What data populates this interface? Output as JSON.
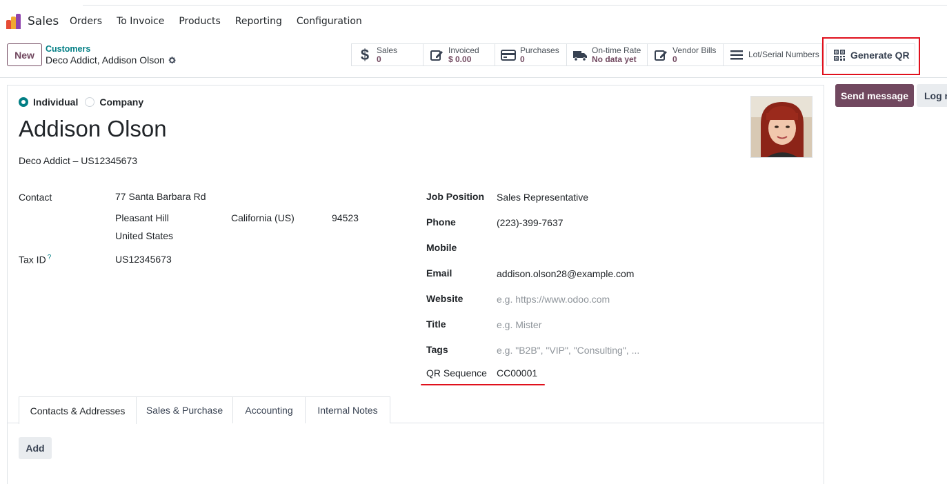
{
  "nav": {
    "app_name": "Sales",
    "menu": [
      "Orders",
      "To Invoice",
      "Products",
      "Reporting",
      "Configuration"
    ]
  },
  "control": {
    "new_label": "New",
    "breadcrumb_parent": "Customers",
    "breadcrumb_current": "Deco Addict, Addison Olson"
  },
  "smart_buttons": [
    {
      "label": "Sales",
      "value": "0",
      "icon": "dollar-icon"
    },
    {
      "label": "Invoiced",
      "value": "$ 0.00",
      "icon": "edit-invoice-icon"
    },
    {
      "label": "Purchases",
      "value": "0",
      "icon": "credit-card-icon"
    },
    {
      "label": "On-time Rate",
      "value": "No data yet",
      "icon": "truck-icon"
    },
    {
      "label": "Vendor Bills",
      "value": "0",
      "icon": "edit-bill-icon"
    },
    {
      "label": "Lot/Serial Numbers",
      "value": "",
      "icon": "list-icon"
    }
  ],
  "generate_qr": {
    "label": "Generate QR",
    "icon": "qrcode-icon"
  },
  "chatter": {
    "send_message": "Send message",
    "log_note": "Log note"
  },
  "form": {
    "type_options": [
      "Individual",
      "Company"
    ],
    "type_selected": "Individual",
    "name": "Addison Olson",
    "company_line": "Deco Addict – US12345673",
    "contact_label": "Contact",
    "street": "77 Santa Barbara Rd",
    "city": "Pleasant Hill",
    "state": "California (US)",
    "zip": "94523",
    "country": "United States",
    "tax_id_label": "Tax ID",
    "tax_id_help": "?",
    "tax_id": "US12345673",
    "job_position_label": "Job Position",
    "job_position": "Sales Representative",
    "phone_label": "Phone",
    "phone": "(223)-399-7637",
    "mobile_label": "Mobile",
    "mobile": "",
    "email_label": "Email",
    "email": "addison.olson28@example.com",
    "website_label": "Website",
    "website_placeholder": "e.g. https://www.odoo.com",
    "title_label": "Title",
    "title_placeholder": "e.g. Mister",
    "tags_label": "Tags",
    "tags_placeholder": "e.g. \"B2B\", \"VIP\", \"Consulting\", ...",
    "qr_sequence_label": "QR Sequence",
    "qr_sequence": "CC00001"
  },
  "tabs": [
    "Contacts & Addresses",
    "Sales & Purchase",
    "Accounting",
    "Internal Notes"
  ],
  "active_tab": "Contacts & Addresses",
  "add_label": "Add",
  "colors": {
    "brand": "#71485f",
    "teal": "#017e84",
    "highlight": "#e0101c"
  }
}
